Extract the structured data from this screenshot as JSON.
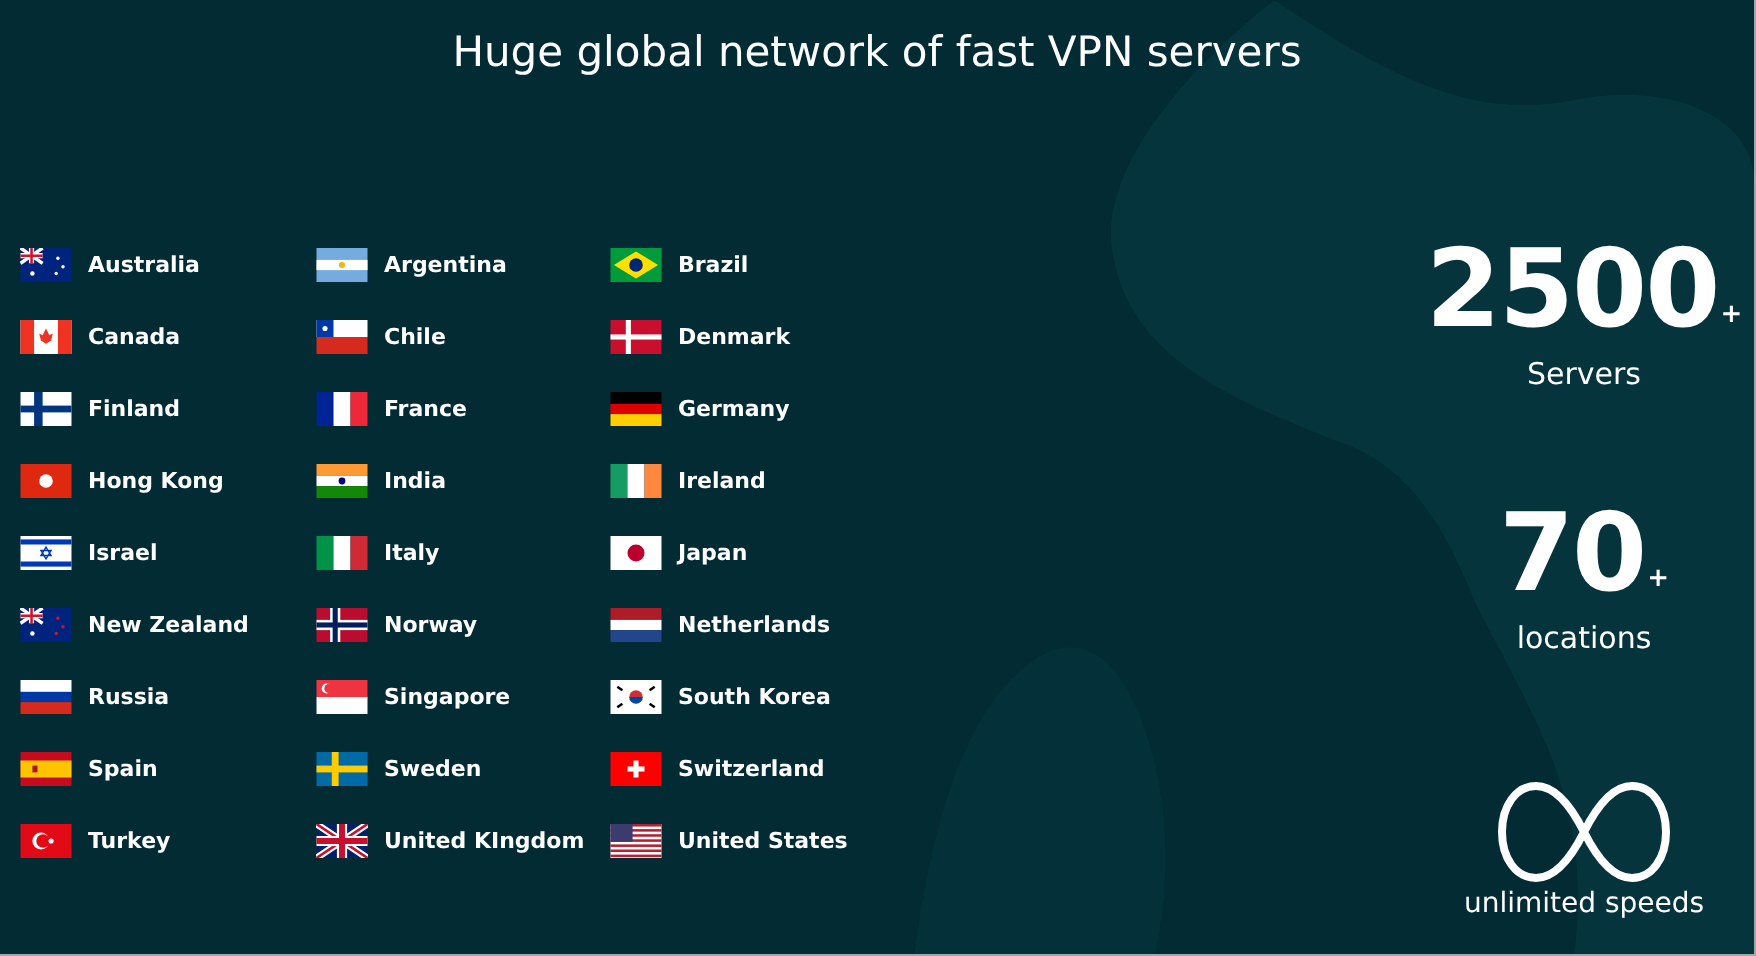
{
  "title": "Huge global network of fast VPN servers",
  "columns": [
    {
      "countries": [
        {
          "name": "Australia",
          "kind": "au"
        },
        {
          "name": "Canada",
          "kind": "ca"
        },
        {
          "name": "Finland",
          "kind": "fi"
        },
        {
          "name": "Hong Kong",
          "kind": "hk"
        },
        {
          "name": "Israel",
          "kind": "il"
        },
        {
          "name": "New Zealand",
          "kind": "nz"
        },
        {
          "name": "Russia",
          "kind": "ru"
        },
        {
          "name": "Spain",
          "kind": "es"
        },
        {
          "name": "Turkey",
          "kind": "tr"
        }
      ]
    },
    {
      "countries": [
        {
          "name": "Argentina",
          "kind": "ar"
        },
        {
          "name": "Chile",
          "kind": "cl"
        },
        {
          "name": "France",
          "kind": "fr"
        },
        {
          "name": "India",
          "kind": "in"
        },
        {
          "name": "Italy",
          "kind": "it"
        },
        {
          "name": "Norway",
          "kind": "no"
        },
        {
          "name": "Singapore",
          "kind": "sg"
        },
        {
          "name": "Sweden",
          "kind": "se"
        },
        {
          "name": "United KIngdom",
          "kind": "gb"
        }
      ]
    },
    {
      "countries": [
        {
          "name": "Brazil",
          "kind": "br"
        },
        {
          "name": "Denmark",
          "kind": "dk"
        },
        {
          "name": "Germany",
          "kind": "de"
        },
        {
          "name": "Ireland",
          "kind": "ie"
        },
        {
          "name": "Japan",
          "kind": "jp"
        },
        {
          "name": "Netherlands",
          "kind": "nl"
        },
        {
          "name": "South Korea",
          "kind": "kr"
        },
        {
          "name": "Switzerland",
          "kind": "ch"
        },
        {
          "name": "United States",
          "kind": "us"
        }
      ]
    }
  ],
  "stats": [
    {
      "value": "2500",
      "suffix": "+",
      "label": "Servers"
    },
    {
      "value": "70",
      "suffix": "+",
      "label": "locations"
    }
  ],
  "unlimited": {
    "label": "unlimited speeds"
  }
}
